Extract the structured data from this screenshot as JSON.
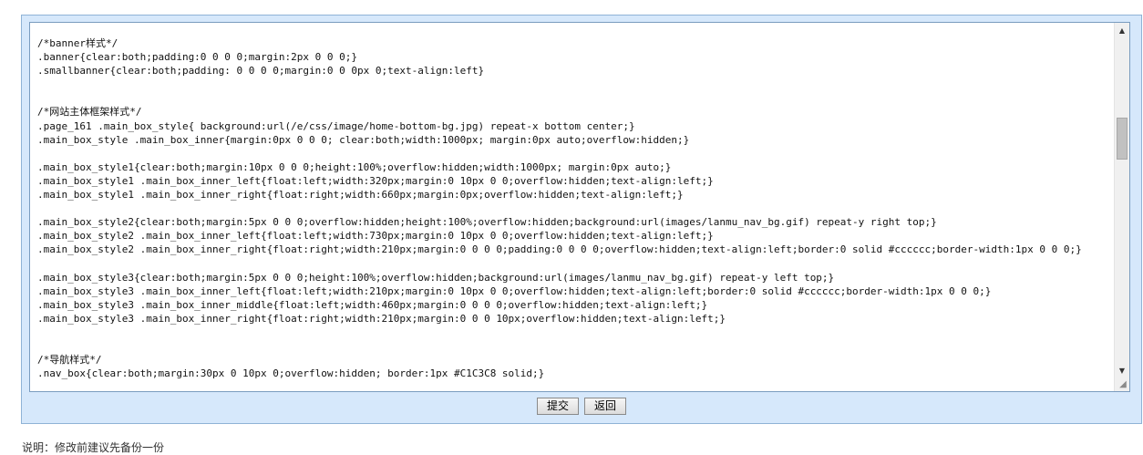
{
  "editor": {
    "lines": [
      "/*banner样式*/",
      ".banner{clear:both;padding:0 0 0 0;margin:2px 0 0 0;}",
      ".smallbanner{clear:both;padding: 0 0 0 0;margin:0 0 0px 0;text-align:left}",
      "",
      "",
      "/*网站主体框架样式*/",
      ".page_161 .main_box_style{ background:url(/e/css/image/home-bottom-bg.jpg) repeat-x bottom center;}",
      ".main_box_style .main_box_inner{margin:0px 0 0 0; clear:both;width:1000px; margin:0px auto;overflow:hidden;}",
      "",
      ".main_box_style1{clear:both;margin:10px 0 0 0;height:100%;overflow:hidden;width:1000px; margin:0px auto;}",
      ".main_box_style1 .main_box_inner_left{float:left;width:320px;margin:0 10px 0 0;overflow:hidden;text-align:left;}",
      ".main_box_style1 .main_box_inner_right{float:right;width:660px;margin:0px;overflow:hidden;text-align:left;}",
      "",
      ".main_box_style2{clear:both;margin:5px 0 0 0;overflow:hidden;height:100%;overflow:hidden;background:url(images/lanmu_nav_bg.gif) repeat-y right top;}",
      ".main_box_style2 .main_box_inner_left{float:left;width:730px;margin:0 10px 0 0;overflow:hidden;text-align:left;}",
      ".main_box_style2 .main_box_inner_right{float:right;width:210px;margin:0 0 0 0;padding:0 0 0 0;overflow:hidden;text-align:left;border:0 solid #cccccc;border-width:1px 0 0 0;}",
      "",
      ".main_box_style3{clear:both;margin:5px 0 0 0;height:100%;overflow:hidden;background:url(images/lanmu_nav_bg.gif) repeat-y left top;}",
      ".main_box_style3 .main_box_inner_left{float:left;width:210px;margin:0 10px 0 0;overflow:hidden;text-align:left;border:0 solid #cccccc;border-width:1px 0 0 0;}",
      ".main_box_style3 .main_box_inner_middle{float:left;width:460px;margin:0 0 0 0;overflow:hidden;text-align:left;}",
      ".main_box_style3 .main_box_inner_right{float:right;width:210px;margin:0 0 0 10px;overflow:hidden;text-align:left;}",
      "",
      "",
      "/*导航样式*/",
      ".nav_box{clear:both;margin:30px 0 10px 0;overflow:hidden; border:1px #C1C3C8 solid;}"
    ]
  },
  "scrollbar": {
    "up_icon": "▲",
    "down_icon": "▼",
    "resize_icon": "◢"
  },
  "buttons": {
    "submit": "提交",
    "back": "返回"
  },
  "footer": {
    "note": "说明：修改前建议先备份一份"
  }
}
